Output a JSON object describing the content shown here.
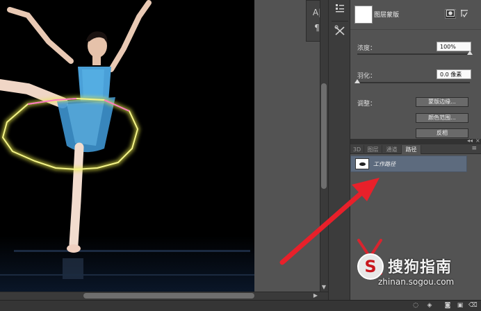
{
  "domain": "photoshop-masks-paths",
  "tool_strip": {
    "char_icon": "A|",
    "para_icon": "¶"
  },
  "properties": {
    "title": "图层蒙版",
    "density_label": "浓度：",
    "density_value": "100%",
    "density_level": 1.0,
    "feather_label": "羽化：",
    "feather_value": "0.0 像素",
    "feather_level": 0.0,
    "adjust_label": "调整：",
    "btn_mask_edge": "蒙版边缘...",
    "btn_color_range": "颜色范围...",
    "btn_invert": "反相"
  },
  "tabs": [
    {
      "label": "3D",
      "active": false
    },
    {
      "label": "图层",
      "active": false
    },
    {
      "label": "通道",
      "active": false
    },
    {
      "label": "路径",
      "active": true
    }
  ],
  "paths_panel": {
    "items": [
      {
        "name": "工作路径"
      }
    ]
  },
  "watermark": {
    "logo_letter": "S",
    "name": "搜狗指南",
    "url": "zhinan.sogou.com"
  },
  "colors": {
    "selection_glow": "#e8e84a",
    "path_highlight": "#ff5ad0",
    "arrow": "#e8202a",
    "active_row": "#5d6b7e"
  },
  "icons": {
    "mask_icon": "mask-icon",
    "vector_mask_icon": "vector-mask-icon"
  }
}
